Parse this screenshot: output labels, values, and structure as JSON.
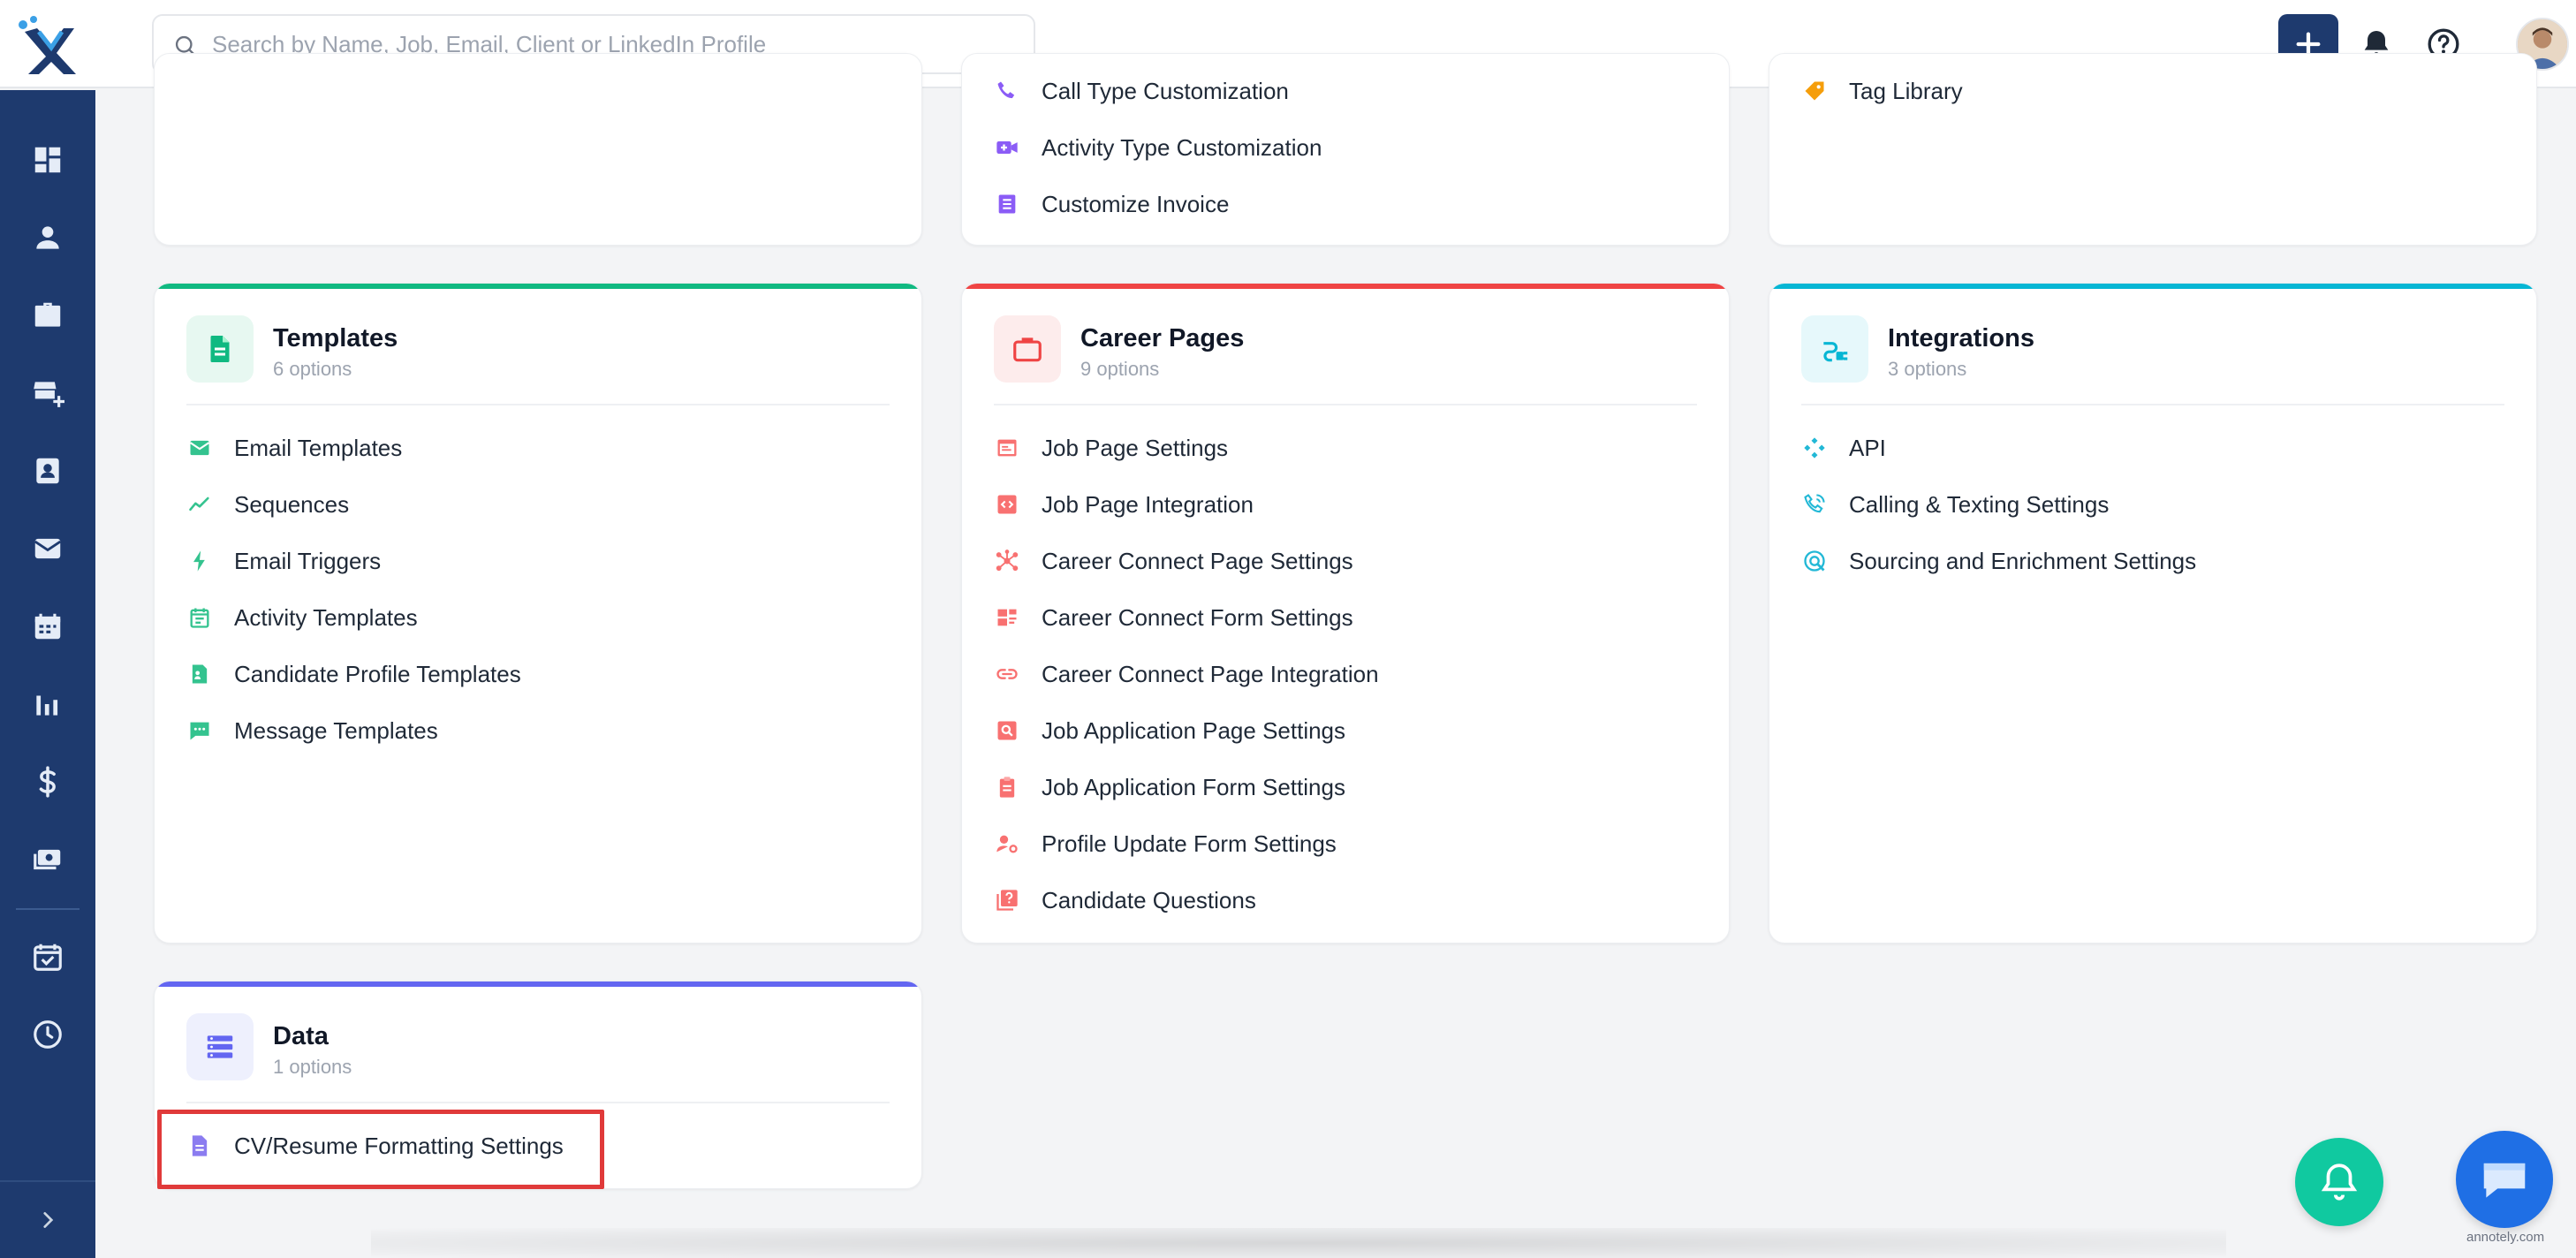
{
  "search": {
    "placeholder": "Search by Name, Job, Email, Client or LinkedIn Profile"
  },
  "colors": {
    "sidebar": "#1e3a6e",
    "green": "#10b981",
    "red": "#ef4444",
    "cyan": "#06b6d4",
    "indigo": "#6366f1",
    "purple": "#8b5cf6"
  },
  "top_cards": {
    "middle": [
      {
        "label": "Call Type Customization",
        "icon": "phone-icon"
      },
      {
        "label": "Activity Type Customization",
        "icon": "video-plus-icon"
      },
      {
        "label": "Customize Invoice",
        "icon": "document-icon"
      }
    ],
    "right": [
      {
        "label": "Tag Library",
        "icon": "tag-icon"
      }
    ]
  },
  "cards": {
    "templates": {
      "title": "Templates",
      "subtitle": "6 options",
      "items": [
        {
          "label": "Email Templates",
          "icon": "mail-icon"
        },
        {
          "label": "Sequences",
          "icon": "trend-line-icon"
        },
        {
          "label": "Email Triggers",
          "icon": "lightning-icon"
        },
        {
          "label": "Activity Templates",
          "icon": "calendar-note-icon"
        },
        {
          "label": "Candidate Profile Templates",
          "icon": "profile-doc-icon"
        },
        {
          "label": "Message Templates",
          "icon": "chat-bubble-icon"
        }
      ]
    },
    "career_pages": {
      "title": "Career Pages",
      "subtitle": "9 options",
      "items": [
        {
          "label": "Job Page Settings",
          "icon": "browser-icon"
        },
        {
          "label": "Job Page Integration",
          "icon": "code-icon"
        },
        {
          "label": "Career Connect Page Settings",
          "icon": "network-icon"
        },
        {
          "label": "Career Connect Form Settings",
          "icon": "form-icon"
        },
        {
          "label": "Career Connect Page Integration",
          "icon": "link-icon"
        },
        {
          "label": "Job Application Page Settings",
          "icon": "search-doc-icon"
        },
        {
          "label": "Job Application Form Settings",
          "icon": "clipboard-icon"
        },
        {
          "label": "Profile Update Form Settings",
          "icon": "user-gear-icon"
        },
        {
          "label": "Candidate Questions",
          "icon": "question-icon"
        }
      ]
    },
    "integrations": {
      "title": "Integrations",
      "subtitle": "3 options",
      "items": [
        {
          "label": "API",
          "icon": "api-icon"
        },
        {
          "label": "Calling & Texting Settings",
          "icon": "phone-call-icon"
        },
        {
          "label": "Sourcing and Enrichment Settings",
          "icon": "radar-icon"
        }
      ]
    },
    "data": {
      "title": "Data",
      "subtitle": "1 options",
      "items": [
        {
          "label": "CV/Resume Formatting Settings",
          "icon": "file-icon"
        }
      ]
    }
  },
  "watermark": "annotely.com"
}
